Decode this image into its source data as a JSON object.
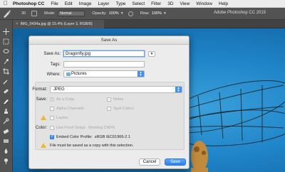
{
  "menubar": {
    "items": [
      "Photoshop CC",
      "File",
      "Edit",
      "Image",
      "Layer",
      "Type",
      "Select",
      "Filter",
      "3D",
      "View",
      "Window",
      "Help"
    ]
  },
  "options_bar": {
    "brush_size": "30",
    "mode_label": "Mode:",
    "mode_value": "Normal",
    "opacity_label": "Opacity:",
    "opacity_value": "100%",
    "flow_label": "Flow:",
    "flow_value": "100%",
    "app_title": "Adobe Photoshop CC 2015"
  },
  "document_tab": {
    "title": "IMG_0434a.jpg @ 15.4% (Layer 3, RGB/8)"
  },
  "dialog": {
    "title": "Save As",
    "save_as_label": "Save As:",
    "save_as_value": "Dragonfly.jpg",
    "tags_label": "Tags:",
    "tags_value": "",
    "where_label": "Where:",
    "where_value": "Pictures",
    "format_label": "Format:",
    "format_value": "JPEG",
    "save_label": "Save:",
    "as_copy_label": "As a Copy",
    "notes_label": "Notes",
    "alpha_label": "Alpha Channels",
    "spot_label": "Spot Colors",
    "layers_label": "Layers",
    "color_label": "Color:",
    "proof_label": "Use Proof Setup:",
    "proof_value": "Working CMYK",
    "embed_label": "Embed Color Profile:",
    "embed_value": "sRGB IEC61966-2.1",
    "warning_text": "File must be saved as a copy with this selection.",
    "cancel_label": "Cancel",
    "save_button_label": "Save"
  },
  "colors": {
    "accent": "#3f8ff5",
    "canvas_sky": "#1f84c8",
    "warning": "#f2b824"
  }
}
